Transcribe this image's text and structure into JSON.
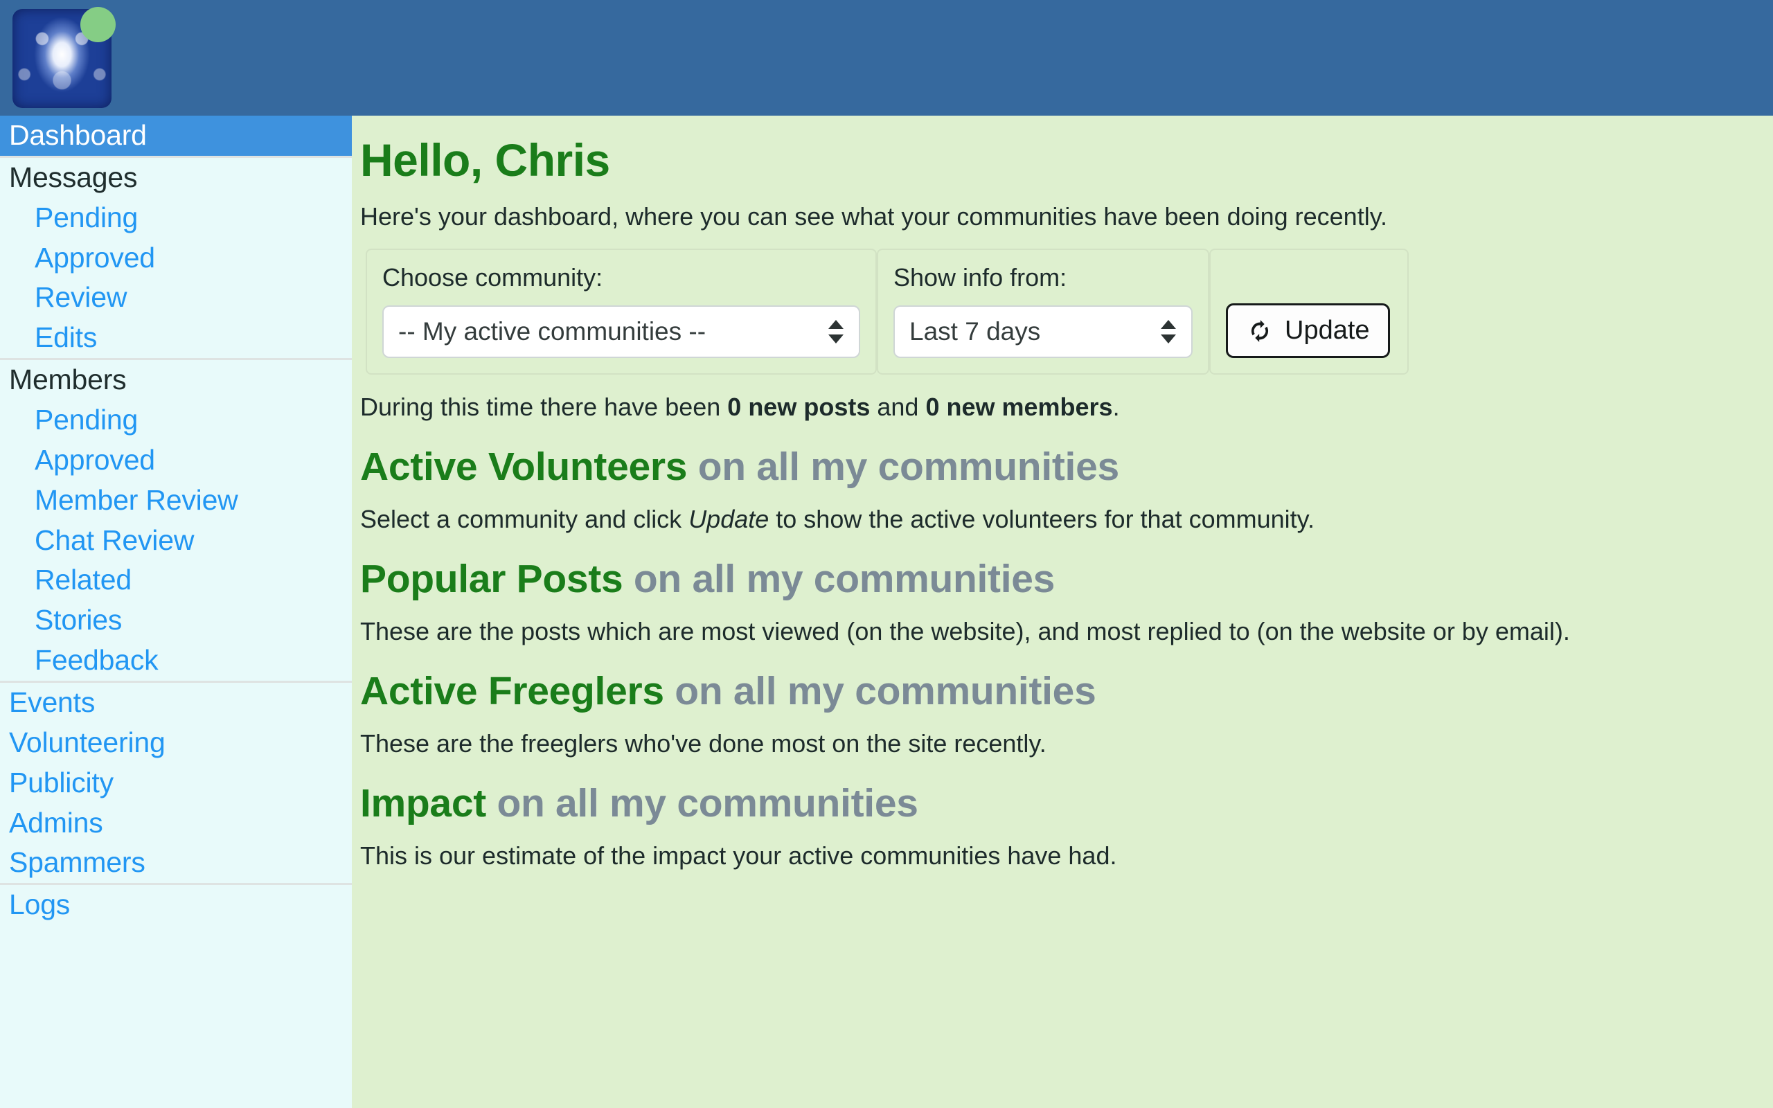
{
  "header": {
    "avatar_name": "user-avatar",
    "status": "online",
    "status_color": "#85CD85",
    "bar_color": "#36699E"
  },
  "sidebar": {
    "background": "#E8FAFA",
    "active_color": "#3E92DE",
    "link_color": "#2196F3",
    "sections": [
      {
        "items": [
          {
            "label": "Dashboard",
            "type": "active"
          }
        ]
      },
      {
        "items": [
          {
            "label": "Messages",
            "type": "heading"
          },
          {
            "label": "Pending",
            "type": "sub"
          },
          {
            "label": "Approved",
            "type": "sub"
          },
          {
            "label": "Review",
            "type": "sub"
          },
          {
            "label": "Edits",
            "type": "sub"
          }
        ]
      },
      {
        "items": [
          {
            "label": "Members",
            "type": "heading"
          },
          {
            "label": "Pending",
            "type": "sub"
          },
          {
            "label": "Approved",
            "type": "sub"
          },
          {
            "label": "Member Review",
            "type": "sub"
          },
          {
            "label": "Chat Review",
            "type": "sub"
          },
          {
            "label": "Related",
            "type": "sub"
          },
          {
            "label": "Stories",
            "type": "sub"
          },
          {
            "label": "Feedback",
            "type": "sub"
          }
        ]
      },
      {
        "items": [
          {
            "label": "Events",
            "type": "link"
          },
          {
            "label": "Volunteering",
            "type": "link"
          },
          {
            "label": "Publicity",
            "type": "link"
          },
          {
            "label": "Admins",
            "type": "link"
          },
          {
            "label": "Spammers",
            "type": "link"
          }
        ]
      },
      {
        "items": [
          {
            "label": "Logs",
            "type": "link"
          }
        ]
      }
    ]
  },
  "main": {
    "background": "#DEF0CF",
    "title": "Hello, Chris",
    "title_color": "#1A7D1A",
    "intro": "Here's your dashboard, where you can see what your communities have been doing recently.",
    "filters": {
      "community": {
        "label": "Choose community:",
        "value": "-- My active communities --"
      },
      "period": {
        "label": "Show info from:",
        "value": "Last 7 days"
      },
      "update_button": {
        "label": "Update",
        "icon": "refresh-icon"
      }
    },
    "summary": {
      "prefix": "During this time there have been ",
      "posts": "0 new posts",
      "middle": " and ",
      "members": "0 new members",
      "suffix": "."
    },
    "sections": [
      {
        "title": "Active Volunteers",
        "scope": " on all my communities",
        "body_before": "Select a community and click ",
        "body_emphasis": "Update",
        "body_after": " to show the active volunteers for that community."
      },
      {
        "title": "Popular Posts",
        "scope": " on all my communities",
        "body_before": "These are the posts which are most viewed (on the website), and most replied to (on the website or by email).",
        "body_emphasis": "",
        "body_after": ""
      },
      {
        "title": "Active Freeglers",
        "scope": " on all my communities",
        "body_before": "These are the freeglers who've done most on the site recently.",
        "body_emphasis": "",
        "body_after": ""
      },
      {
        "title": "Impact",
        "scope": " on all my communities",
        "body_before": "This is our estimate of the impact your active communities have had.",
        "body_emphasis": "",
        "body_after": ""
      }
    ]
  }
}
